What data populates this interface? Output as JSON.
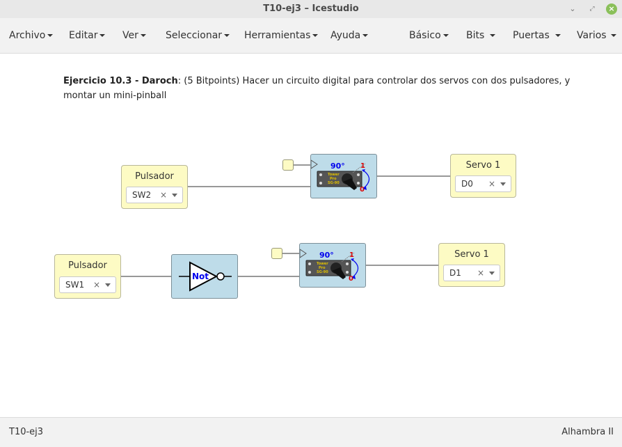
{
  "window": {
    "title": "T10-ej3 – Icestudio"
  },
  "menu": {
    "left": [
      {
        "label": "Archivo"
      },
      {
        "label": "Editar"
      },
      {
        "label": "Ver"
      },
      {
        "label": "Seleccionar"
      },
      {
        "label": "Herramientas"
      },
      {
        "label": "Ayuda"
      }
    ],
    "right": [
      {
        "label": "Básico"
      },
      {
        "label": "Bits"
      },
      {
        "label": "Puertas"
      },
      {
        "label": "Varios"
      }
    ]
  },
  "description": {
    "bold": "Ejercicio 10.3 - Daroch",
    "text": ": (5 Bitpoints) Hacer un circuito digital para controlar dos servos con dos pulsadores, y montar un mini-pinball"
  },
  "blocks": {
    "pulsador_top": {
      "title": "Pulsador",
      "value": "SW2",
      "clear": "×"
    },
    "pulsador_bottom": {
      "title": "Pulsador",
      "value": "SW1",
      "clear": "×"
    },
    "servo_top": {
      "title": "Servo 1",
      "value": "D0",
      "clear": "×"
    },
    "servo_bottom": {
      "title": "Servo 1",
      "value": "D1",
      "clear": "×"
    },
    "servo_icon_top": {
      "angle": "90°",
      "one": "1",
      "zero": "0",
      "brand1": "Tower",
      "brand2": "Pro",
      "model": "SG-90"
    },
    "servo_icon_bottom": {
      "angle": "90°",
      "one": "1",
      "zero": "0",
      "brand1": "Tower",
      "brand2": "Pro",
      "model": "SG-90"
    },
    "not_gate": {
      "label": "Not"
    }
  },
  "colors": {
    "accent_blue": "#0000ee",
    "accent_red": "#dd0000",
    "block_yellow": "#fdfbc4",
    "block_blue": "#bedce9"
  },
  "status": {
    "project": "T10-ej3",
    "board": "Alhambra II"
  }
}
